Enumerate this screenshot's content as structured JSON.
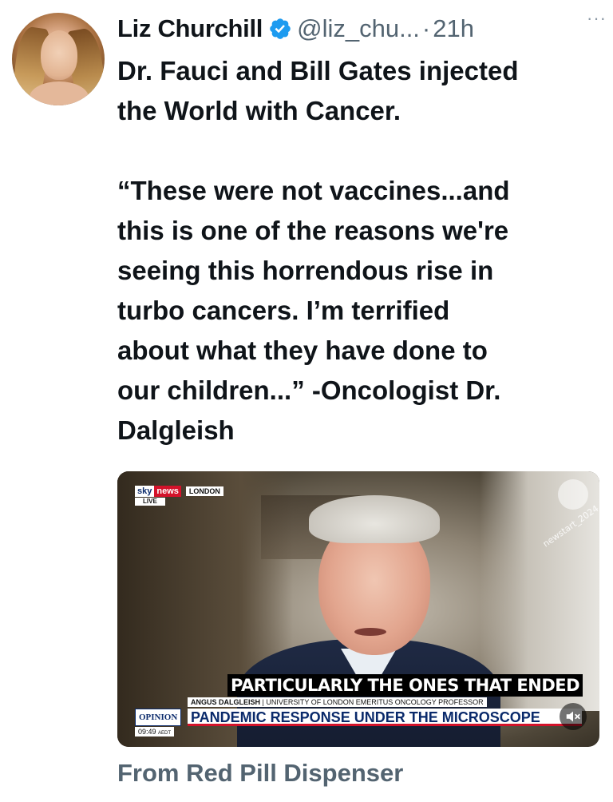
{
  "author": {
    "display_name": "Liz Churchill",
    "handle": "@liz_chu...",
    "separator": "·",
    "time": "21h",
    "verified_color": "#1d9bf0",
    "more_icon": "···"
  },
  "tweet": {
    "text": "Dr. Fauci and Bill Gates injected\nthe World with Cancer.\n\n“These were not vaccines...and\nthis is one of the reasons we're\nseeing this horrendous rise in\nturbo cancers. I’m terrified\nabout what they have done to\nour children...” -Oncologist Dr.\nDalgleish"
  },
  "video": {
    "network_sky": "sky",
    "network_news": "news",
    "location": "LONDON",
    "live": "LIVE",
    "watermark": "newstart_2024",
    "caption": "PARTICULARLY THE ONES THAT ENDED",
    "speaker_name": "ANGUS DALGLEISH",
    "speaker_title": "| UNIVERSITY OF LONDON EMERITUS ONCOLOGY PROFESSOR",
    "segment_tag": "OPINION",
    "headline": "PANDEMIC RESPONSE UNDER THE MICROSCOPE",
    "clock": "09:49",
    "timezone": "AEDT",
    "mute_icon": "muted-speaker-icon"
  },
  "source_label": "From Red Pill Dispenser"
}
